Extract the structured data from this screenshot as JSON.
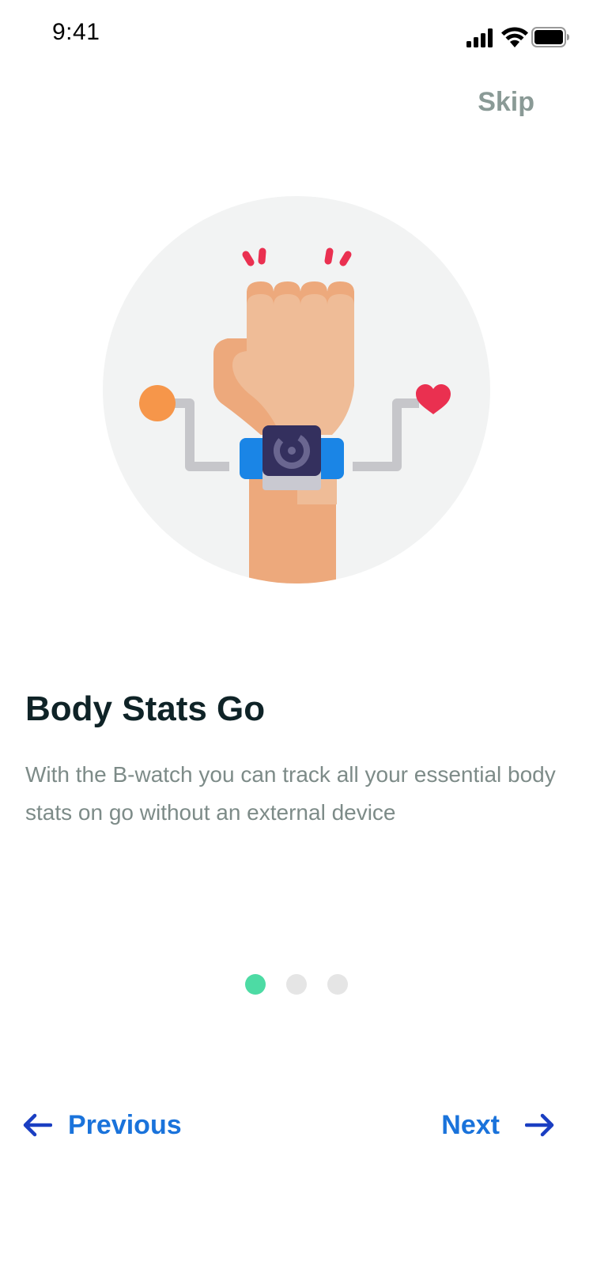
{
  "status_bar": {
    "time": "9:41",
    "icons": [
      "signal-icon",
      "wifi-icon",
      "battery-icon"
    ]
  },
  "header": {
    "skip_label": "Skip"
  },
  "hero": {
    "illustration": "smartwatch-wrist-illustration",
    "colors": {
      "circle_bg": "#f2f3f3",
      "skin": "#efbc97",
      "skin_shadow": "#eda97c",
      "band": "#1a85e6",
      "watch_face": "#34305e",
      "accent_red": "#ea3050",
      "accent_orange": "#f6964a",
      "wire": "#c6c6ca"
    }
  },
  "content": {
    "title": "Body Stats Go",
    "description": "With the B-watch you can track all your essential body stats on go without an external device"
  },
  "pager": {
    "total": 3,
    "active_index": 0,
    "active_color": "#4ddba4",
    "inactive_color": "#e5e5e5"
  },
  "navigation": {
    "previous_label": "Previous",
    "next_label": "Next",
    "previous_icon": "arrow-left-icon",
    "next_icon": "arrow-right-icon",
    "accent_color": "#1a73db"
  }
}
